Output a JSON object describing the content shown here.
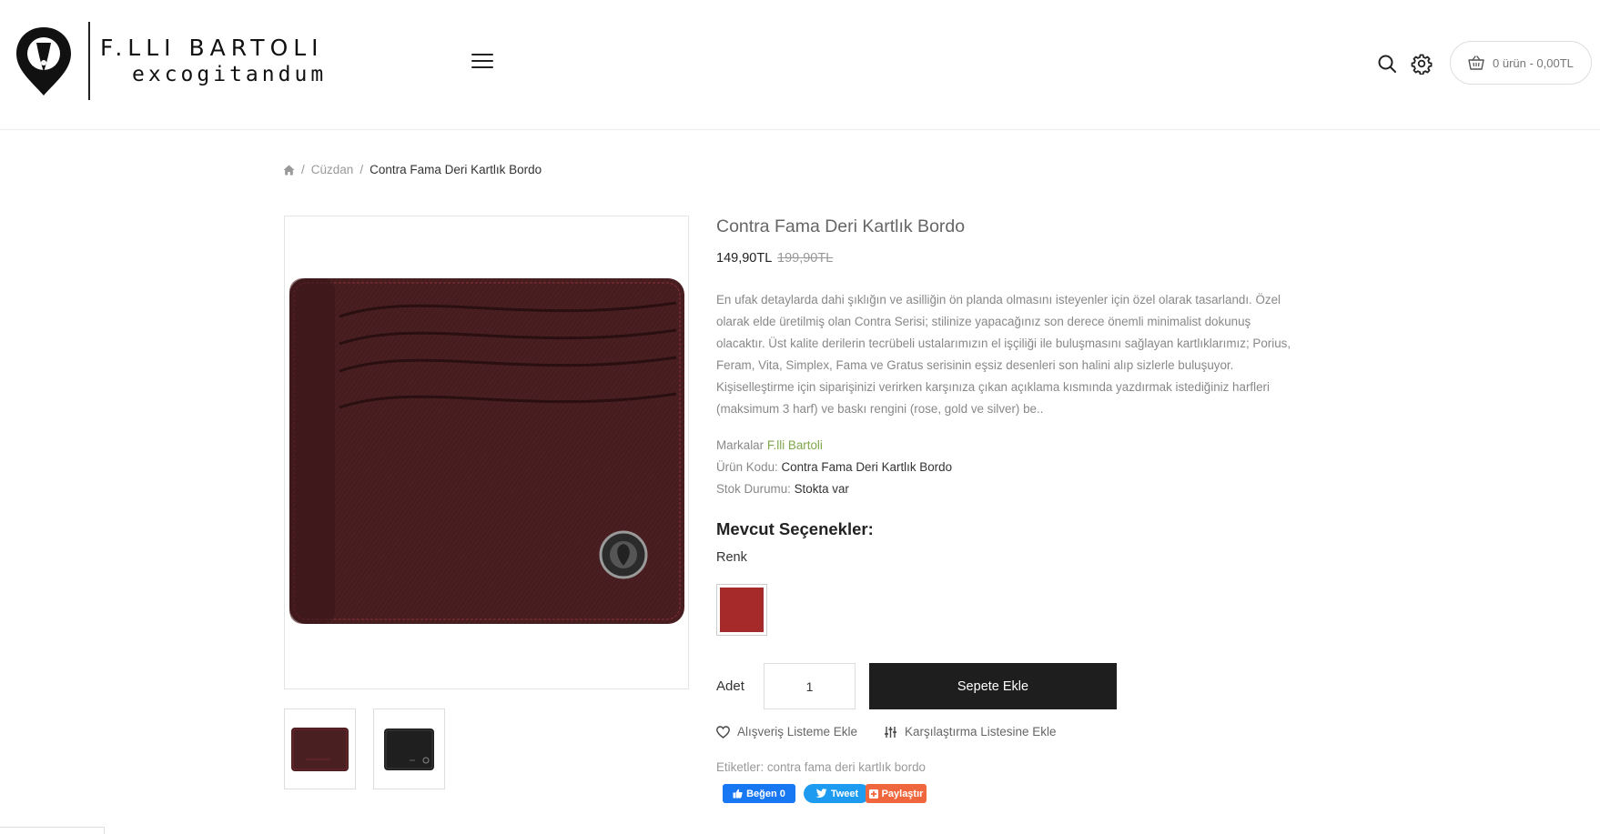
{
  "brand": {
    "name": "F.LLI BARTOLI",
    "tagline": "excogitandum"
  },
  "header": {
    "cart_text": "0 ürün - 0,00TL"
  },
  "breadcrumb": {
    "items": [
      "Cüzdan",
      "Contra Fama Deri Kartlık Bordo"
    ],
    "separator": "/"
  },
  "product": {
    "title": "Contra Fama Deri Kartlık Bordo",
    "price_new": "149,90TL",
    "price_old": "199,90TL",
    "description": "En ufak detaylarda dahi şıklığın ve asilliğin ön planda olmasını isteyenler için özel olarak tasarlandı. Özel olarak elde üretilmiş olan Contra Serisi; stilinize yapacağınız son derece önemli minimalist dokunuş olacaktır. Üst kalite derilerin tecrübeli ustalarımızın el işçiliği ile buluşmasını sağlayan kartlıklarımız; Porius, Feram, Vita, Simplex, Fama ve Gratus serisinin eşsiz desenleri son halini alıp sizlerle buluşuyor. Kişiselleştirme için siparişinizi verirken karşınıza çıkan açıklama kısmında yazdırmak istediğiniz harfleri (maksimum 3 harf) ve baskı rengini (rose, gold ve silver) be..",
    "brand_label": "Markalar",
    "brand_value": "F.lli Bartoli",
    "code_label": "Ürün Kodu:",
    "code_value": "Contra Fama Deri Kartlık Bordo",
    "stock_label": "Stok Durumu:",
    "stock_value": "Stokta var",
    "options_heading": "Mevcut Seçenekler:",
    "option_name": "Renk",
    "swatch_color": "#a72a2b",
    "qty_label": "Adet",
    "qty_value": "1",
    "add_to_cart": "Sepete Ekle",
    "wishlist": "Alışveriş Listeme Ekle",
    "compare": "Karşılaştırma Listesine Ekle",
    "tags_label": "Etiketler:",
    "tags_value": "contra fama deri kartlık bordo"
  },
  "social": {
    "fb_like": "Beğen 0",
    "tweet": "Tweet",
    "share": "Paylaştır"
  },
  "colors": {
    "accent_green": "#7ea64a",
    "button_dark": "#1e1e1e",
    "wallet_burgundy": "#4a1f22"
  }
}
